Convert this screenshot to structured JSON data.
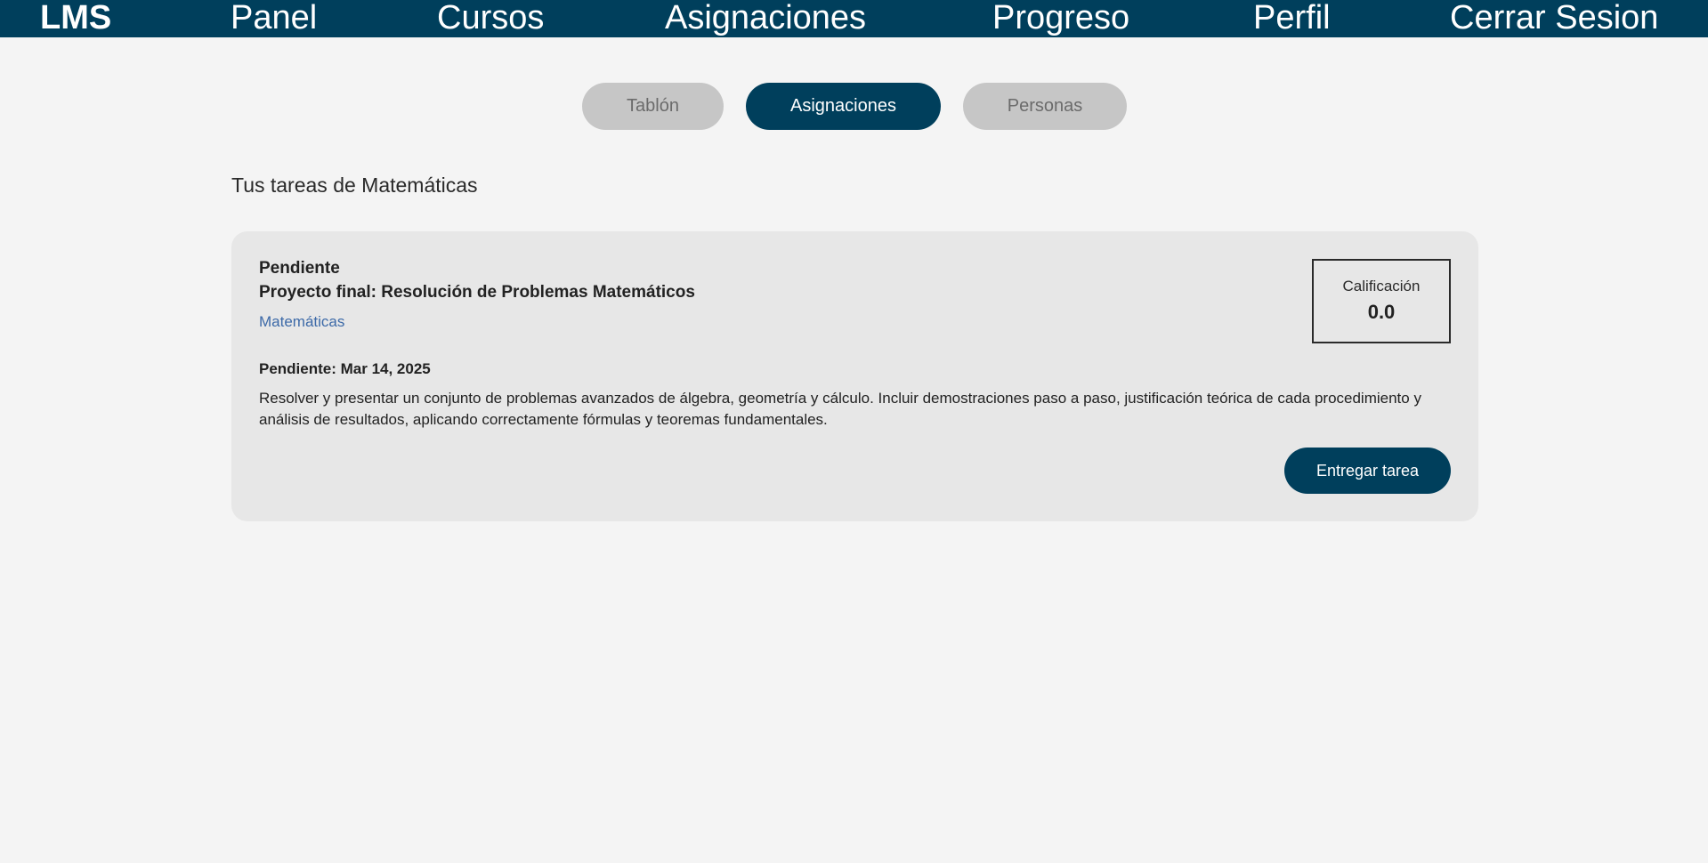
{
  "nav": {
    "brand": "LMS",
    "items": [
      {
        "label": "Panel"
      },
      {
        "label": "Cursos"
      },
      {
        "label": "Asignaciones"
      },
      {
        "label": "Progreso"
      },
      {
        "label": "Perfil"
      },
      {
        "label": "Cerrar Sesion"
      }
    ]
  },
  "tabs": [
    {
      "label": "Tablón",
      "active": false
    },
    {
      "label": "Asignaciones",
      "active": true
    },
    {
      "label": "Personas",
      "active": false
    }
  ],
  "section_title": "Tus tareas de Matemáticas",
  "assignment": {
    "status": "Pendiente",
    "title": "Proyecto final: Resolución de Problemas Matemáticos",
    "course": "Matemáticas",
    "grade_label": "Calificación",
    "grade_value": "0.0",
    "due": "Pendiente: Mar 14, 2025",
    "description": "Resolver y presentar un conjunto de problemas avanzados de álgebra, geometría y cálculo. Incluir demostraciones paso a paso, justificación teórica de cada procedimiento y análisis de resultados, aplicando correctamente fórmulas y teoremas fundamentales.",
    "submit_label": "Entregar tarea"
  },
  "colors": {
    "nav_background": "#003f5c",
    "accent": "#003f5c",
    "page_background": "#f4f4f4",
    "card_background": "#e7e7e7",
    "inactive_tab": "#c6c6c6",
    "link": "#3d6aa8"
  }
}
